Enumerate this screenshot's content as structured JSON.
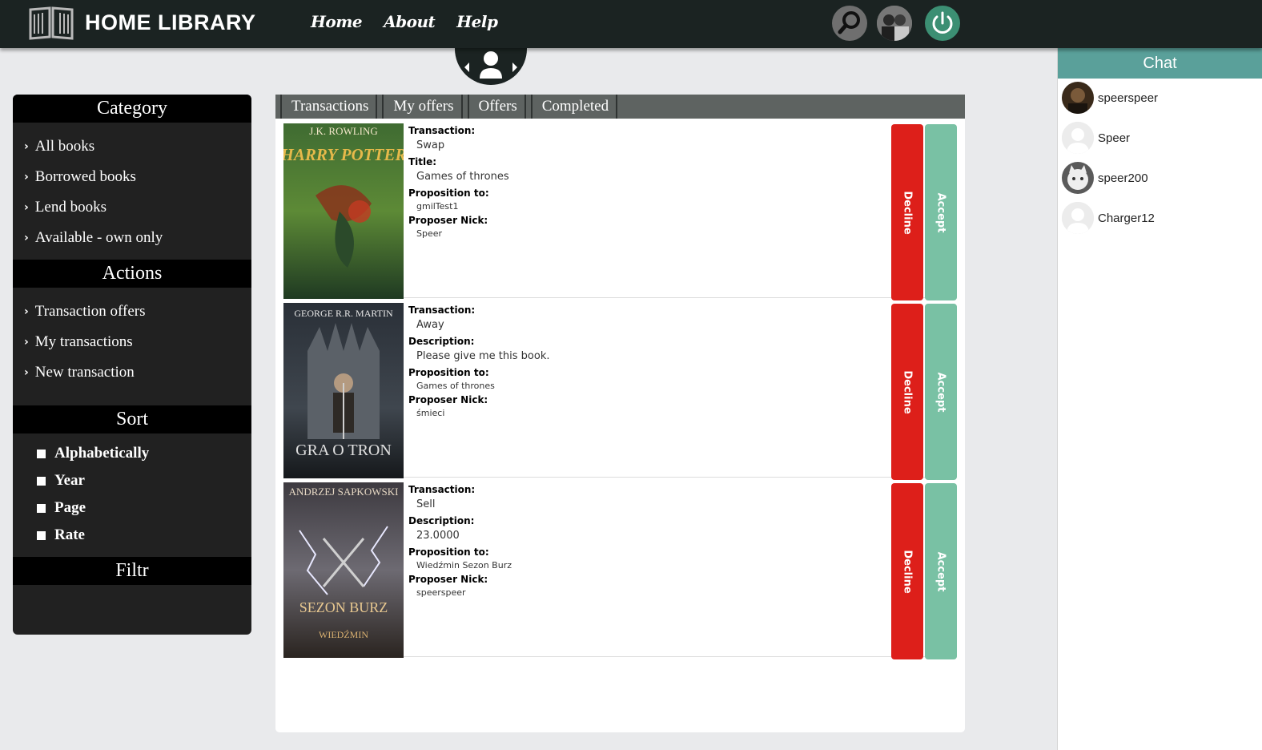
{
  "header": {
    "title": "HOME LIBRARY",
    "nav": [
      "Home",
      "About",
      "Help"
    ],
    "icons": [
      "book-logo-icon",
      "search-icon",
      "user-avatar",
      "power-icon"
    ]
  },
  "sidebar": {
    "category_title": "Category",
    "category_items": [
      "All books",
      "Borrowed books",
      "Lend books",
      "Available - own only"
    ],
    "actions_title": "Actions",
    "action_items": [
      "Transaction offers",
      "My transactions",
      "New transaction"
    ],
    "sort_title": "Sort",
    "sort_items": [
      "Alphabetically",
      "Year",
      "Page",
      "Rate"
    ],
    "filter_title": "Filtr"
  },
  "tabs": [
    "Transactions",
    "My offers",
    "Offers",
    "Completed"
  ],
  "transactions": [
    {
      "cover": {
        "author": "J.K. ROWLING",
        "title": "HARRY POTTER"
      },
      "fields": [
        {
          "label": "Transaction:",
          "value": "Swap"
        },
        {
          "label": "Title:",
          "value": "Games of thrones"
        },
        {
          "label": "Proposition to:",
          "value": "gmilTest1"
        },
        {
          "label": "Proposer Nick:",
          "value": "Speer"
        }
      ],
      "decline": "Decline",
      "accept": "Accept"
    },
    {
      "cover": {
        "author": "GEORGE R.R. MARTIN",
        "title": "GRA O TRON"
      },
      "fields": [
        {
          "label": "Transaction:",
          "value": "Away"
        },
        {
          "label": "Description:",
          "value": "Please give me this book."
        },
        {
          "label": "Proposition to:",
          "value": "Games of thrones"
        },
        {
          "label": "Proposer Nick:",
          "value": "śmieci"
        }
      ],
      "decline": "Decline",
      "accept": "Accept"
    },
    {
      "cover": {
        "author": "ANDRZEJ SAPKOWSKI",
        "title": "SEZON BURZ",
        "subtitle": "WIEDŹMIN"
      },
      "fields": [
        {
          "label": "Transaction:",
          "value": "Sell"
        },
        {
          "label": "Description:",
          "value": "23.0000"
        },
        {
          "label": "Proposition to:",
          "value": "Wiedźmin Sezon Burz"
        },
        {
          "label": "Proposer Nick:",
          "value": "speerspeer"
        }
      ],
      "decline": "Decline",
      "accept": "Accept"
    }
  ],
  "chat": {
    "title": "Chat",
    "users": [
      "speerspeer",
      "Speer",
      "speer200",
      "Charger12"
    ]
  }
}
